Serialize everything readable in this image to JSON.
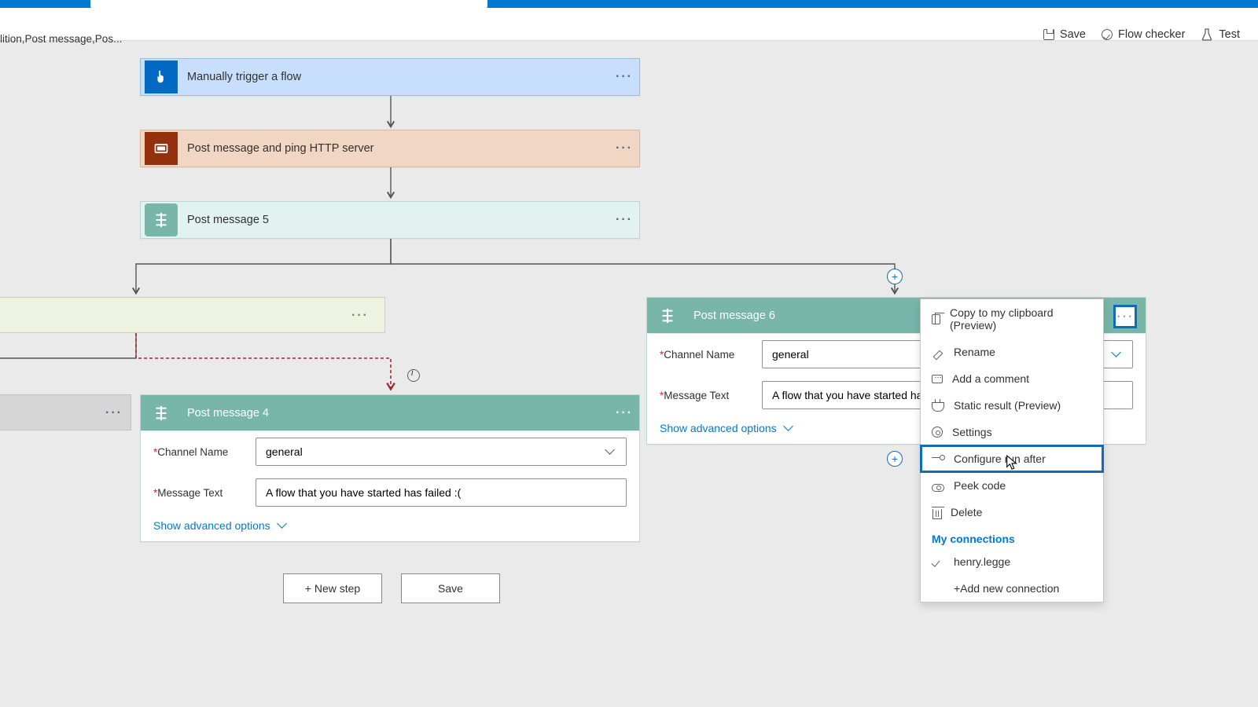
{
  "breadcrumb": "lition,Post message,Pos...",
  "toolbar": {
    "save": "Save",
    "flow_checker": "Flow checker",
    "test": "Test"
  },
  "cards": {
    "trigger": "Manually trigger a flow",
    "http": "Post message and ping HTTP server",
    "pm5": "Post message 5",
    "pm4": "Post message 4",
    "pm6": "Post message 6"
  },
  "pm4": {
    "channel_label": "Channel Name",
    "channel_value": "general",
    "msg_label": "Message Text",
    "msg_value": "A flow that you have started has failed :(",
    "adv": "Show advanced options"
  },
  "pm6": {
    "channel_label": "Channel Name",
    "channel_value": "general",
    "msg_label": "Message Text",
    "msg_value": "A flow that you have started has",
    "adv": "Show advanced options"
  },
  "buttons": {
    "new_step": "+ New step",
    "save": "Save"
  },
  "menu": {
    "copy": "Copy to my clipboard (Preview)",
    "rename": "Rename",
    "comment": "Add a comment",
    "static": "Static result (Preview)",
    "settings": "Settings",
    "configure": "Configure run after",
    "peek": "Peek code",
    "delete": "Delete",
    "section": "My connections",
    "conn1": "henry.legge",
    "add": "+Add new connection"
  }
}
